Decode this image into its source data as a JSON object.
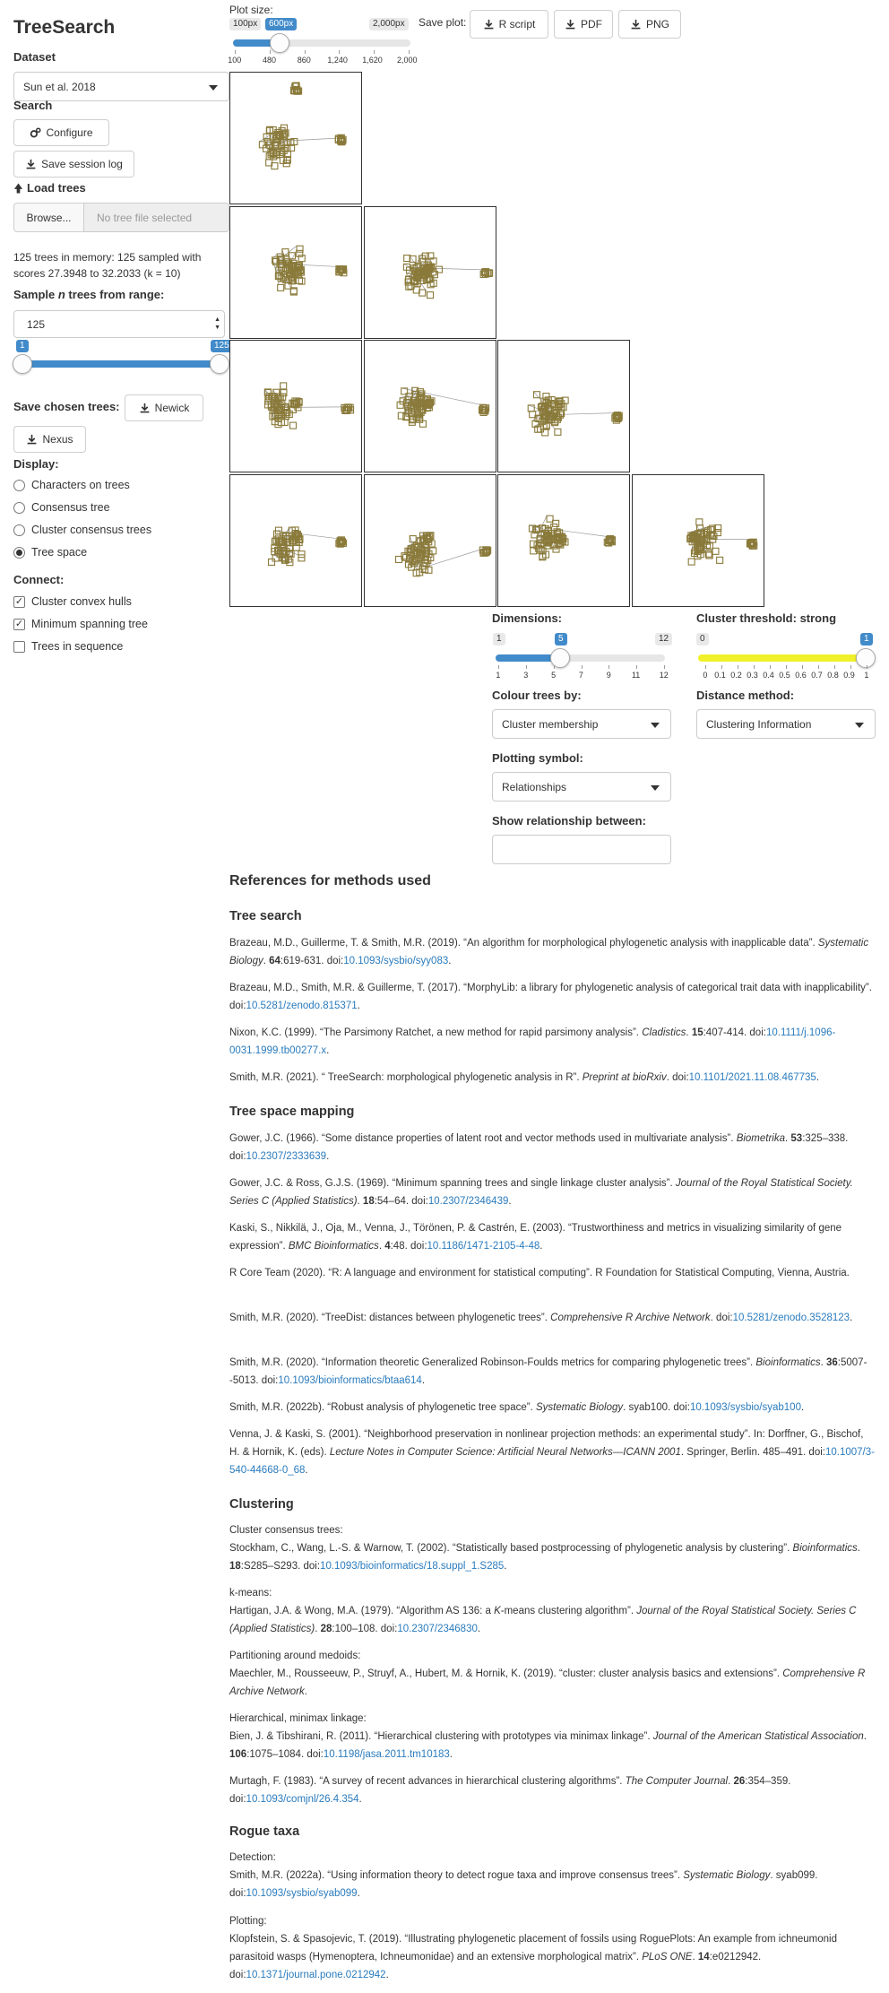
{
  "app_title": "TreeSearch",
  "sidebar": {
    "dataset_label": "Dataset",
    "dataset_value": "Sun et al. 2018",
    "search_label": "Search",
    "configure_button": "Configure",
    "save_session_button": "Save session log",
    "load_trees_label": "Load trees",
    "browse_button": "Browse...",
    "file_placeholder": "No tree file selected",
    "memory_status": "125 trees in memory: 125 sampled with scores 27.3948 to 32.2033 (k = 10)",
    "sample_label_pre": "Sample ",
    "sample_label_n": "n",
    "sample_label_post": " trees from range:",
    "sample_value": "125",
    "range_min": "1",
    "range_max": "125",
    "save_chosen_label": "Save chosen trees:",
    "newick_button": "Newick",
    "nexus_button": "Nexus",
    "display_label": "Display:",
    "display_options": [
      {
        "label": "Characters on trees",
        "selected": false
      },
      {
        "label": "Consensus tree",
        "selected": false
      },
      {
        "label": "Cluster consensus trees",
        "selected": false
      },
      {
        "label": "Tree space",
        "selected": true
      }
    ],
    "connect_label": "Connect:",
    "connect_options": [
      {
        "label": "Cluster convex hulls",
        "checked": true
      },
      {
        "label": "Minimum spanning tree",
        "checked": true
      },
      {
        "label": "Trees in sequence",
        "checked": false
      }
    ]
  },
  "plot_controls": {
    "plot_size_label": "Plot size:",
    "size_min_badge": "100px",
    "size_value_badge": "600px",
    "size_max_badge": "2,000px",
    "size_ticks": [
      "100",
      "480",
      "860",
      "1,240",
      "1,620",
      "2,000"
    ],
    "size_value": 600,
    "save_plot_label": "Save plot:",
    "r_script_button": "R script",
    "pdf_button": "PDF",
    "png_button": "PNG"
  },
  "tree_space": {
    "point_color": "#8a7a3a",
    "panels": 10
  },
  "settings": {
    "dimensions_label": "Dimensions:",
    "dim_min_badge": "1",
    "dim_value_badge": "5",
    "dim_max_badge": "12",
    "dim_ticks": [
      "1",
      "3",
      "5",
      "7",
      "9",
      "11",
      "12"
    ],
    "dim_value": 5,
    "cluster_threshold_label": "Cluster threshold: strong",
    "thr_min_badge": "0",
    "thr_value_badge": "1",
    "thr_ticks": [
      "0",
      "0.1",
      "0.2",
      "0.3",
      "0.4",
      "0.5",
      "0.6",
      "0.7",
      "0.8",
      "0.9",
      "1"
    ],
    "thr_value": 1,
    "colour_label": "Colour trees by:",
    "colour_value": "Cluster membership",
    "distance_label": "Distance method:",
    "distance_value": "Clustering Information",
    "symbol_label": "Plotting symbol:",
    "symbol_value": "Relationships",
    "relationship_label": "Show relationship between:",
    "relationship_value": ""
  },
  "references": {
    "title": "References for methods used",
    "tree_search_heading": "Tree search",
    "tree_space_heading": "Tree space mapping",
    "clustering_heading": "Clustering",
    "rogue_heading": "Rogue taxa",
    "cluster_consensus_label": "Cluster consensus trees:",
    "kmeans_label": "k-means:",
    "pam_label": "Partitioning around medoids:",
    "hier_label": "Hierarchical, minimax linkage:",
    "detection_label": "Detection:",
    "plotting_label": "Plotting:"
  }
}
